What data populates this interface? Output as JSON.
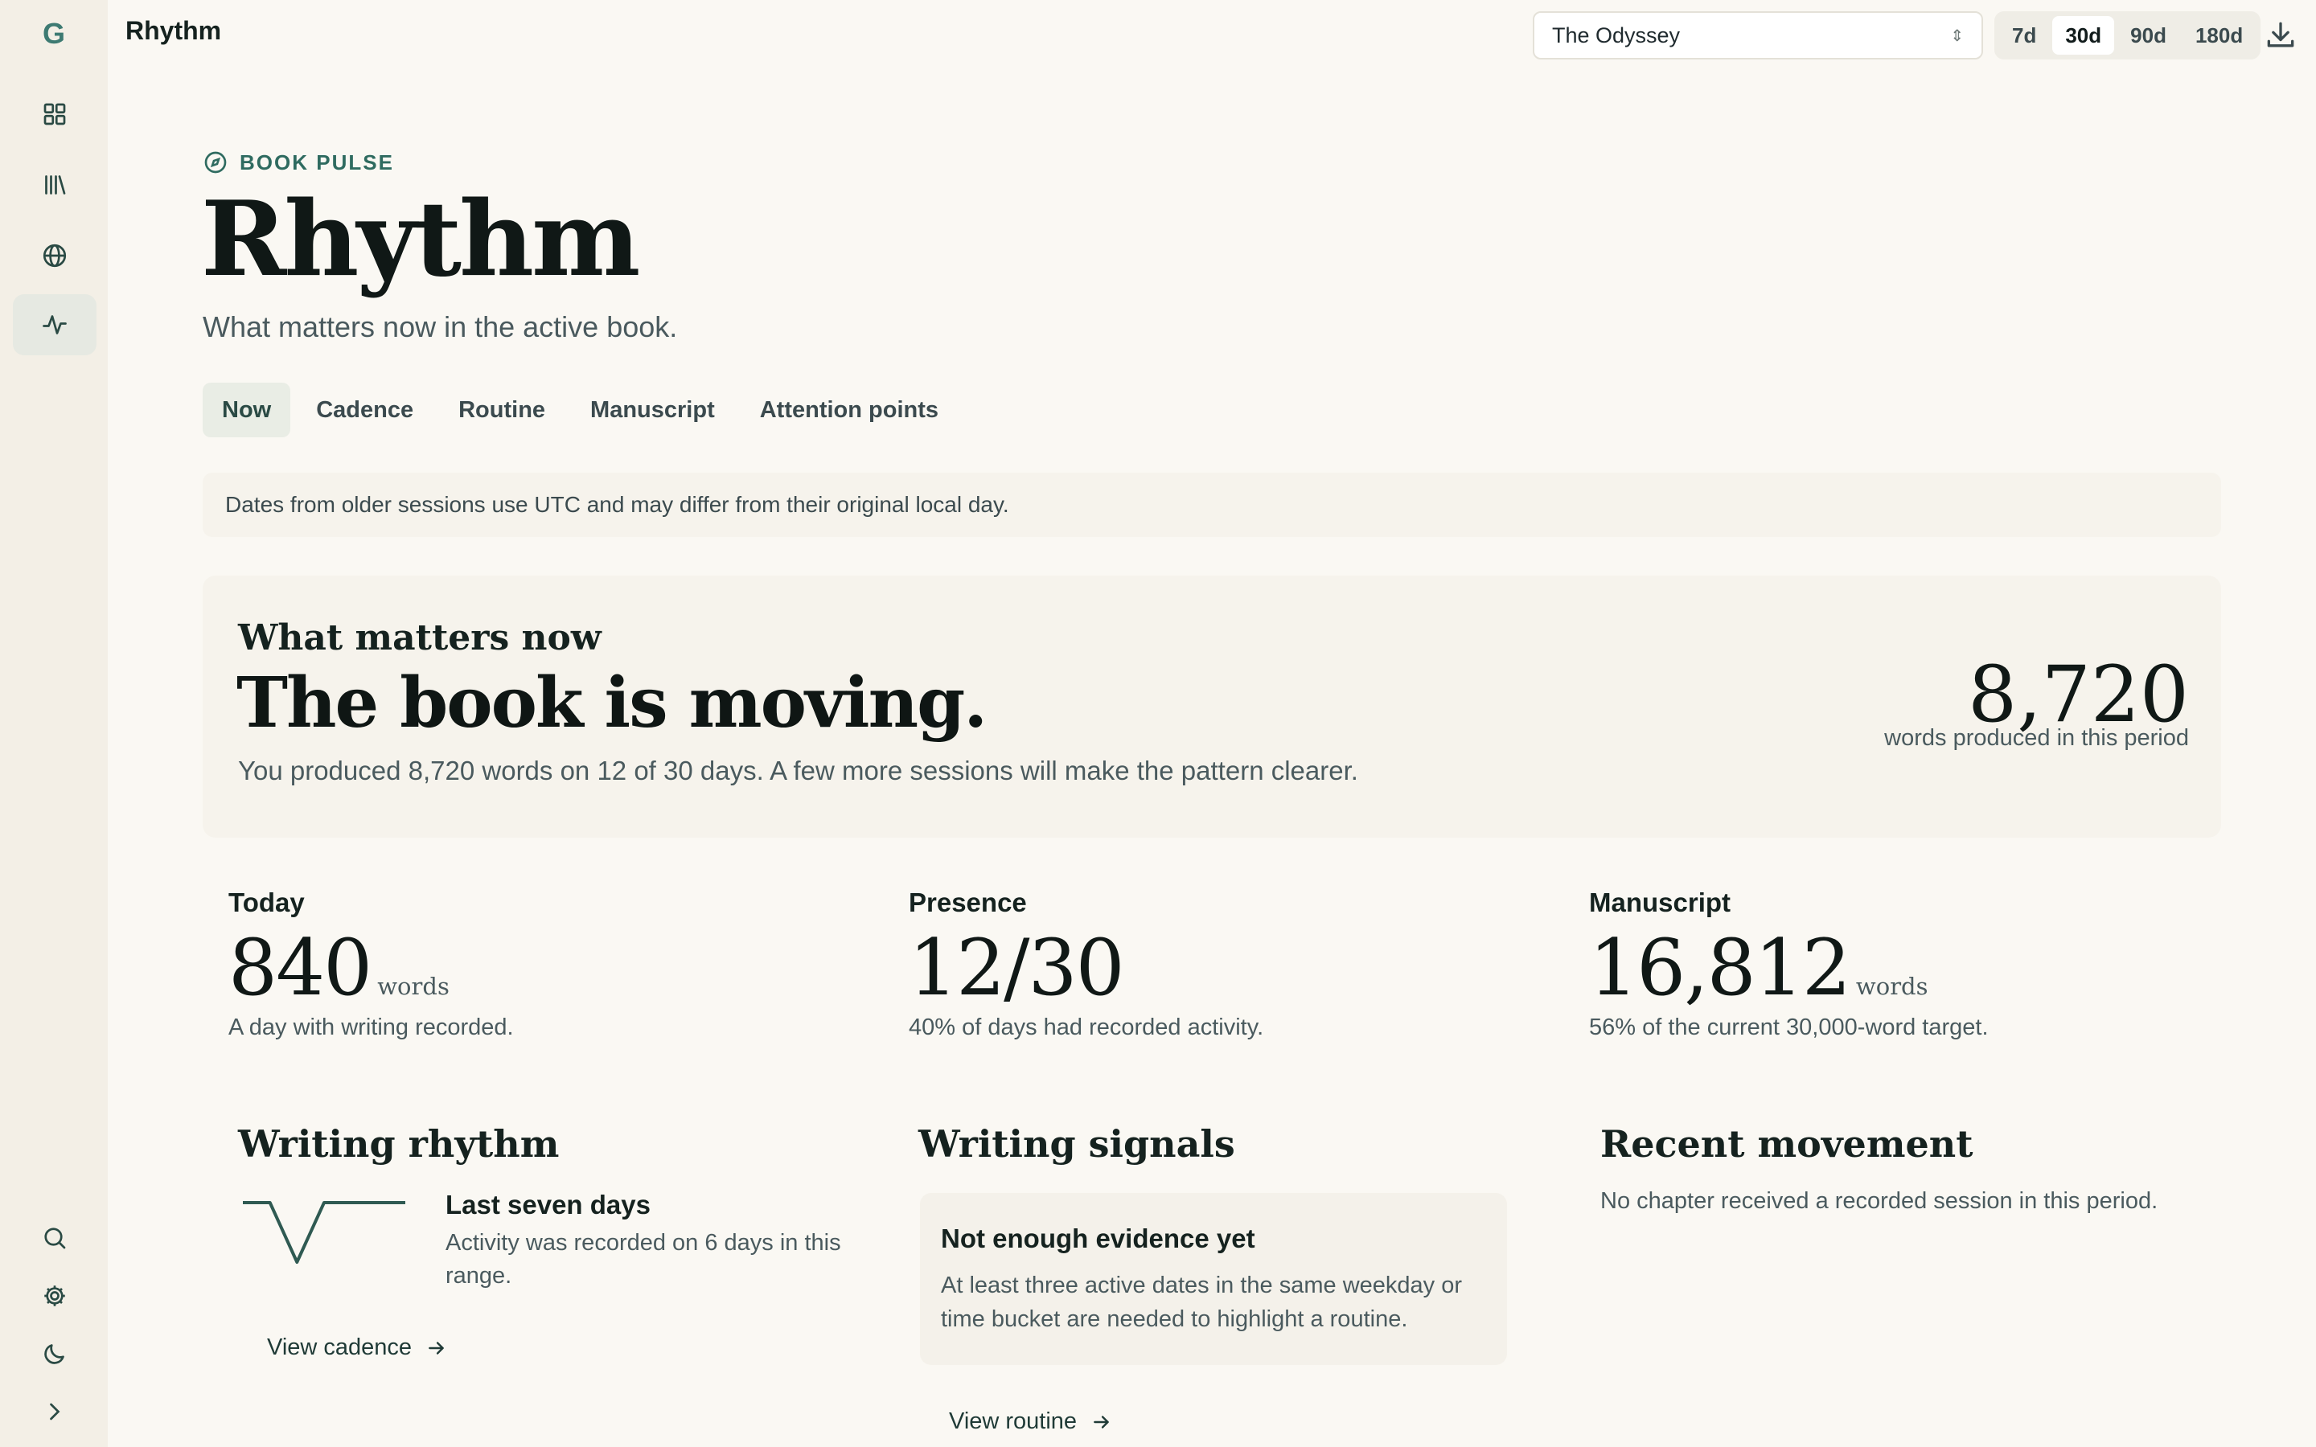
{
  "app": {
    "logo_glyph": "G",
    "title": "Rhythm"
  },
  "sidebar": {
    "items": [
      {
        "name": "dashboard",
        "icon": "grid-icon"
      },
      {
        "name": "library",
        "icon": "library-icon"
      },
      {
        "name": "world",
        "icon": "globe-icon"
      },
      {
        "name": "rhythm",
        "icon": "activity-icon",
        "active": true
      }
    ],
    "bottom": [
      {
        "name": "search",
        "icon": "search-icon"
      },
      {
        "name": "settings",
        "icon": "gear-icon"
      },
      {
        "name": "theme",
        "icon": "moon-icon"
      },
      {
        "name": "expand",
        "icon": "chevron-right-icon"
      }
    ]
  },
  "header": {
    "book_select": {
      "value": "The Odyssey"
    },
    "ranges": [
      "7d",
      "30d",
      "90d",
      "180d"
    ],
    "active_range": "30d"
  },
  "page": {
    "eyebrow": "BOOK PULSE",
    "title": "Rhythm",
    "subtitle": "What matters now in the active book."
  },
  "tabs": [
    "Now",
    "Cadence",
    "Routine",
    "Manuscript",
    "Attention points"
  ],
  "active_tab": "Now",
  "notice": "Dates from older sessions use UTC and may differ from their original local day.",
  "hero": {
    "kicker": "What matters now",
    "headline": "The book is moving.",
    "description": "You produced 8,720 words on 12 of 30 days. A few more sessions will make the pattern clearer.",
    "number": "8,720",
    "number_label": "words produced in this period"
  },
  "stats": {
    "today": {
      "label": "Today",
      "value": "840",
      "unit": "words",
      "desc": "A day with writing recorded."
    },
    "presence": {
      "label": "Presence",
      "value": "12/30",
      "desc": "40% of days had recorded activity."
    },
    "manuscript": {
      "label": "Manuscript",
      "value": "16,812",
      "unit": "words",
      "desc": "56% of the current 30,000-word target."
    }
  },
  "writing_rhythm": {
    "title": "Writing rhythm",
    "heading": "Last seven days",
    "desc": "Activity was recorded on 6 days in this range.",
    "link": "View cadence",
    "spark_values": [
      1,
      1,
      0,
      1,
      1,
      1,
      1
    ]
  },
  "writing_signals": {
    "title": "Writing signals",
    "heading": "Not enough evidence yet",
    "desc": "At least three active dates in the same weekday or time bucket are needed to highlight a routine.",
    "link": "View routine"
  },
  "recent_movement": {
    "title": "Recent movement",
    "desc": "No chapter received a recorded session in this period."
  },
  "colors": {
    "accent": "#2f6b60",
    "background": "#faf8f3",
    "sidebar": "#f3efe6",
    "card": "#f6f3ec"
  }
}
